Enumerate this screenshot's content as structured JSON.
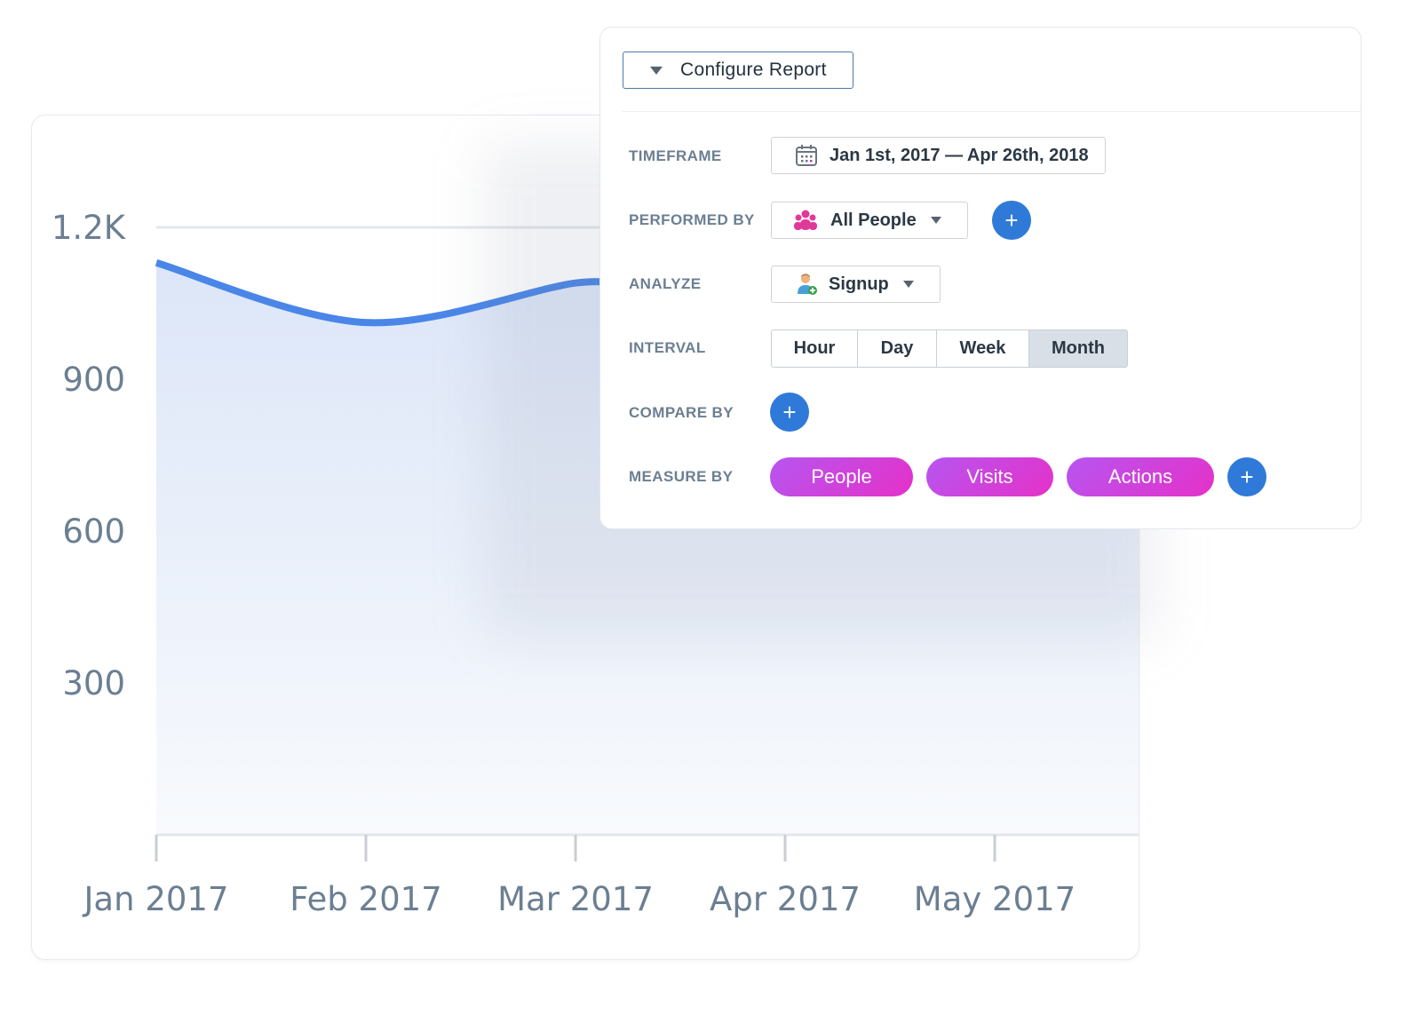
{
  "chart_data": {
    "type": "area",
    "title": "",
    "xlabel": "",
    "ylabel": "",
    "categories": [
      "Jan 2017",
      "Feb 2017",
      "Mar 2017",
      "Apr 2017",
      "May 2017"
    ],
    "series": [
      {
        "name": "Signup",
        "values": [
          1130,
          1012,
          1090,
          null,
          null
        ]
      }
    ],
    "yticks": [
      {
        "value": 300,
        "label": "300"
      },
      {
        "value": 600,
        "label": "600"
      },
      {
        "value": 900,
        "label": "900"
      },
      {
        "value": 1200,
        "label": "1.2K"
      }
    ],
    "ylim": [
      0,
      1200
    ],
    "grid": true,
    "legend": "none",
    "colors": {
      "line": "#4a86e8",
      "fill": "#dce6f8"
    }
  },
  "config": {
    "toggle_label": "Configure Report",
    "timeframe": {
      "label": "TIMEFRAME",
      "value": "Jan 1st, 2017 — Apr 26th, 2018",
      "icon": "calendar-icon"
    },
    "performed_by": {
      "label": "PERFORMED BY",
      "value": "All People",
      "icon": "people-group-icon",
      "add": "+"
    },
    "analyze": {
      "label": "ANALYZE",
      "value": "Signup",
      "icon": "user-add-icon"
    },
    "interval": {
      "label": "INTERVAL",
      "options": [
        "Hour",
        "Day",
        "Week",
        "Month"
      ],
      "selected": "Month"
    },
    "compare_by": {
      "label": "COMPARE BY",
      "add": "+"
    },
    "measure_by": {
      "label": "MEASURE BY",
      "pills": [
        "People",
        "Visits",
        "Actions"
      ],
      "add": "+"
    },
    "colors": {
      "accent": "#2f7ad8",
      "pill_start": "#b755f0",
      "pill_end": "#e531c8",
      "people_icon": "#e0399a"
    }
  }
}
